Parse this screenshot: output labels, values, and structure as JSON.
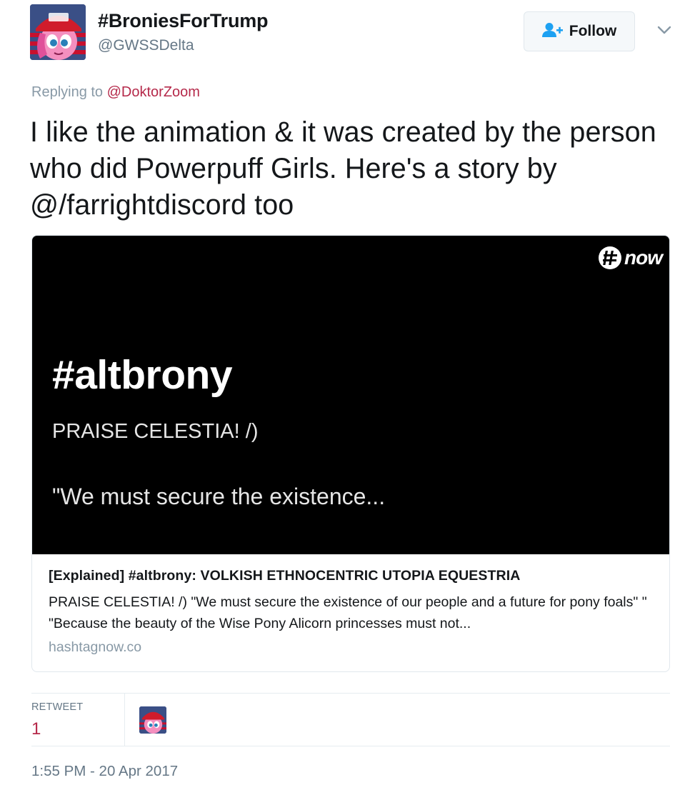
{
  "user": {
    "display_name": "#BroniesForTrump",
    "handle": "@GWSSDelta"
  },
  "follow_button": {
    "label": "Follow"
  },
  "reply": {
    "prefix": "Replying to",
    "mention": "@DoktorZoom"
  },
  "tweet": {
    "text": "I like the animation & it was created by the person who did Powerpuff Girls. Here's a story by @/farrightdiscord too"
  },
  "card": {
    "image": {
      "logo_text": "now",
      "hashtag": "#altbrony",
      "subtitle": "PRAISE CELESTIA! /)",
      "quote": "\"We must secure the existence..."
    },
    "title": "[Explained] #altbrony: VOLKISH ETHNOCENTRIC UTOPIA EQUESTRIA",
    "description": "PRAISE CELESTIA! /) \"We must secure the existence of our people and a future for pony foals\" \" \"Because the beauty of the Wise Pony Alicorn princesses must not...",
    "domain": "hashtagnow.co"
  },
  "stats": {
    "retweet_label": "RETWEET",
    "retweet_count": "1"
  },
  "timestamp": "1:55 PM - 20 Apr 2017",
  "colors": {
    "accent": "#b5294a",
    "follow_icon": "#1da1f2",
    "secondary_text": "#657786"
  },
  "icons": {
    "follow": "person-add-icon",
    "caret": "chevron-down-icon",
    "logo": "hashtag-now-logo"
  }
}
